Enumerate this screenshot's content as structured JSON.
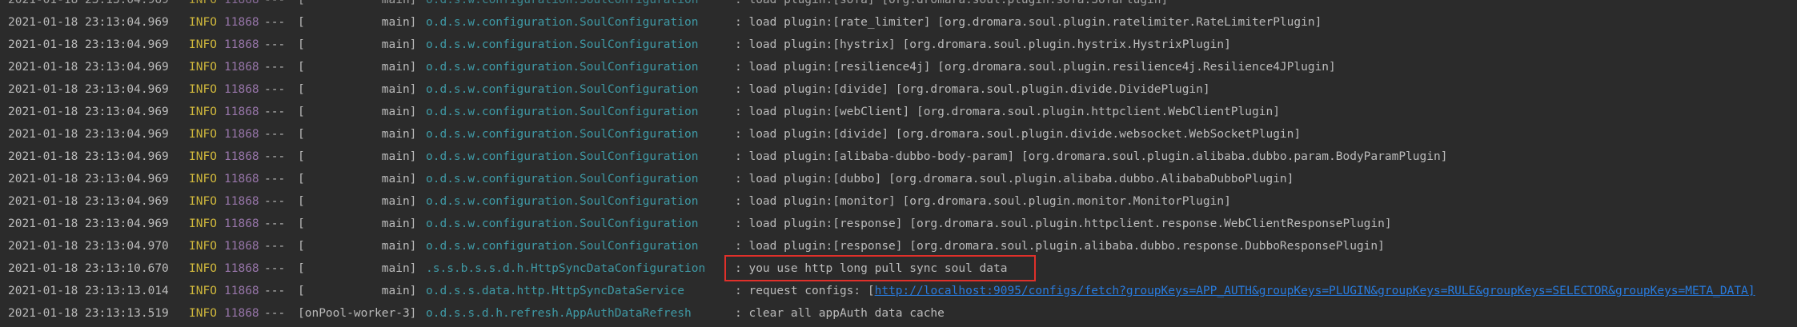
{
  "colors": {
    "background": "#2b2b2b",
    "text": "#bbbbbb",
    "level_info": "#d0b83c",
    "pid": "#9876aa",
    "logger": "#3f9aa6",
    "link": "#287bde",
    "highlight_border": "#e0302a"
  },
  "log_lines": [
    {
      "ts": "2021-01-18 23:13:04.969",
      "level": "INFO",
      "pid": "11868",
      "sep": "---",
      "thread": "[           main]",
      "logger": "o.d.s.w.configuration.SoulConfiguration",
      "msg": ": load plugin:[rate_limiter] [org.dromara.soul.plugin.ratelimiter.RateLimiterPlugin]"
    },
    {
      "ts": "2021-01-18 23:13:04.969",
      "level": "INFO",
      "pid": "11868",
      "sep": "---",
      "thread": "[           main]",
      "logger": "o.d.s.w.configuration.SoulConfiguration",
      "msg": ": load plugin:[hystrix] [org.dromara.soul.plugin.hystrix.HystrixPlugin]"
    },
    {
      "ts": "2021-01-18 23:13:04.969",
      "level": "INFO",
      "pid": "11868",
      "sep": "---",
      "thread": "[           main]",
      "logger": "o.d.s.w.configuration.SoulConfiguration",
      "msg": ": load plugin:[resilience4j] [org.dromara.soul.plugin.resilience4j.Resilience4JPlugin]"
    },
    {
      "ts": "2021-01-18 23:13:04.969",
      "level": "INFO",
      "pid": "11868",
      "sep": "---",
      "thread": "[           main]",
      "logger": "o.d.s.w.configuration.SoulConfiguration",
      "msg": ": load plugin:[divide] [org.dromara.soul.plugin.divide.DividePlugin]"
    },
    {
      "ts": "2021-01-18 23:13:04.969",
      "level": "INFO",
      "pid": "11868",
      "sep": "---",
      "thread": "[           main]",
      "logger": "o.d.s.w.configuration.SoulConfiguration",
      "msg": ": load plugin:[webClient] [org.dromara.soul.plugin.httpclient.WebClientPlugin]"
    },
    {
      "ts": "2021-01-18 23:13:04.969",
      "level": "INFO",
      "pid": "11868",
      "sep": "---",
      "thread": "[           main]",
      "logger": "o.d.s.w.configuration.SoulConfiguration",
      "msg": ": load plugin:[divide] [org.dromara.soul.plugin.divide.websocket.WebSocketPlugin]"
    },
    {
      "ts": "2021-01-18 23:13:04.969",
      "level": "INFO",
      "pid": "11868",
      "sep": "---",
      "thread": "[           main]",
      "logger": "o.d.s.w.configuration.SoulConfiguration",
      "msg": ": load plugin:[alibaba-dubbo-body-param] [org.dromara.soul.plugin.alibaba.dubbo.param.BodyParamPlugin]"
    },
    {
      "ts": "2021-01-18 23:13:04.969",
      "level": "INFO",
      "pid": "11868",
      "sep": "---",
      "thread": "[           main]",
      "logger": "o.d.s.w.configuration.SoulConfiguration",
      "msg": ": load plugin:[dubbo] [org.dromara.soul.plugin.alibaba.dubbo.AlibabaDubboPlugin]"
    },
    {
      "ts": "2021-01-18 23:13:04.969",
      "level": "INFO",
      "pid": "11868",
      "sep": "---",
      "thread": "[           main]",
      "logger": "o.d.s.w.configuration.SoulConfiguration",
      "msg": ": load plugin:[monitor] [org.dromara.soul.plugin.monitor.MonitorPlugin]"
    },
    {
      "ts": "2021-01-18 23:13:04.969",
      "level": "INFO",
      "pid": "11868",
      "sep": "---",
      "thread": "[           main]",
      "logger": "o.d.s.w.configuration.SoulConfiguration",
      "msg": ": load plugin:[response] [org.dromara.soul.plugin.httpclient.response.WebClientResponsePlugin]"
    },
    {
      "ts": "2021-01-18 23:13:04.970",
      "level": "INFO",
      "pid": "11868",
      "sep": "---",
      "thread": "[           main]",
      "logger": "o.d.s.w.configuration.SoulConfiguration",
      "msg": ": load plugin:[response] [org.dromara.soul.plugin.alibaba.dubbo.response.DubboResponsePlugin]"
    },
    {
      "ts": "2021-01-18 23:13:10.670",
      "level": "INFO",
      "pid": "11868",
      "sep": "---",
      "thread": "[           main]",
      "logger": ".s.s.b.s.s.d.h.HttpSyncDataConfiguration",
      "msg": ": you use http long pull sync soul data"
    },
    {
      "ts": "2021-01-18 23:13:13.014",
      "level": "INFO",
      "pid": "11868",
      "sep": "---",
      "thread": "[           main]",
      "logger": "o.d.s.s.data.http.HttpSyncDataService",
      "msg_prefix": ": request configs: [",
      "link": "http://localhost:9095/configs/fetch?groupKeys=APP_AUTH&groupKeys=PLUGIN&groupKeys=RULE&groupKeys=SELECTOR&groupKeys=META_DATA]"
    },
    {
      "ts": "2021-01-18 23:13:13.519",
      "level": "INFO",
      "pid": "11868",
      "sep": "---",
      "thread": "[onPool-worker-3]",
      "logger": "o.d.s.s.d.h.refresh.AppAuthDataRefresh",
      "msg": ": clear all appAuth data cache"
    }
  ]
}
